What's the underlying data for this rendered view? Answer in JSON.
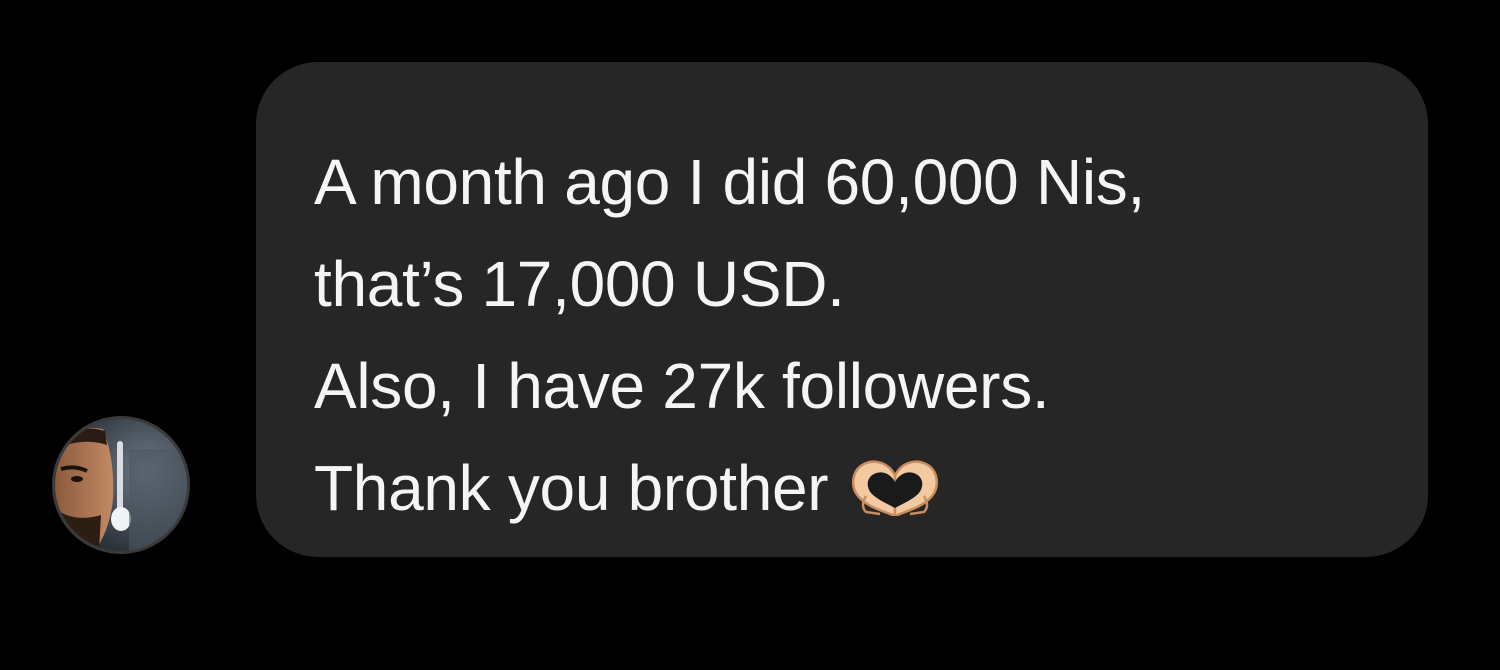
{
  "conversation": {
    "sender": {
      "avatar_icon": "profile-photo-icon"
    },
    "message": {
      "lines": [
        "A month ago I did 60,000 Nis,",
        "that’s 17,000 USD.",
        "Also, I have 27k followers.",
        "Thank you brother"
      ],
      "emoji_icon": "heart-hands-icon"
    },
    "colors": {
      "background": "#000000",
      "bubble": "#262626",
      "text": "#f5f5f5"
    }
  }
}
